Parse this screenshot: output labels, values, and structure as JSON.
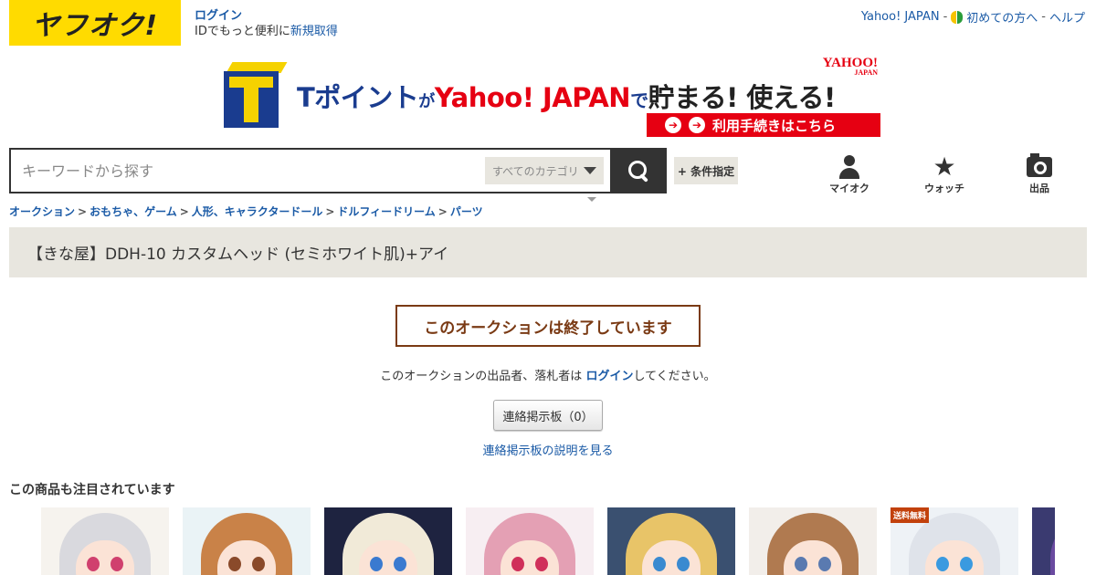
{
  "header": {
    "logo_text": "ヤフオク!",
    "login_label": "ログイン",
    "login_sub_prefix": "IDでもっと便利に",
    "register_label": "新規取得",
    "toplinks": {
      "yahoo_japan": "Yahoo! JAPAN",
      "sep1": "-",
      "beginner": "初めての方へ",
      "sep2": "-",
      "help": "ヘルプ"
    }
  },
  "banner": {
    "text_t": "Tポイント",
    "text_ga": "が",
    "text_yahoo": "Yahoo! JAPAN",
    "text_de": "で",
    "text_main": "貯まる! 使える!",
    "logo_yahoo": "YAHOO!",
    "logo_japan": "JAPAN",
    "cta": "利用手続きはこちら"
  },
  "search": {
    "placeholder": "キーワードから探す",
    "category": "すべてのカテゴリ",
    "condition_button": "+ 条件指定"
  },
  "nav": {
    "myauction": "マイオク",
    "watch": "ウォッチ",
    "sell": "出品"
  },
  "breadcrumb": {
    "items": [
      "オークション",
      "おもちゃ、ゲーム",
      "人形、キャラクタードール",
      "ドルフィードリーム",
      "パーツ"
    ],
    "separator": ">"
  },
  "item": {
    "title": "【きな屋】DDH-10 カスタムヘッド (セミホワイト肌)+アイ"
  },
  "ended": {
    "message": "このオークションは終了しています",
    "note_prefix": "このオークションの出品者、落札者は ",
    "note_login": "ログイン",
    "note_suffix": "してください。",
    "board_button": "連絡掲示板（0）",
    "board_help": "連絡掲示板の説明を見る"
  },
  "recommended": {
    "title": "この商品も注目されています",
    "free_shipping_badge": "送料無料",
    "items": [
      {
        "hair": "#d9d9de",
        "eye": "#d0406e",
        "bg": "#f6f3ee"
      },
      {
        "hair": "#c98248",
        "eye": "#8a4a2a",
        "bg": "#eaf3f6"
      },
      {
        "hair": "#f1ead8",
        "eye": "#3a7ad0",
        "bg": "#1e2340"
      },
      {
        "hair": "#e4a0b4",
        "eye": "#d0305a",
        "bg": "#f7eef2"
      },
      {
        "hair": "#e8c468",
        "eye": "#3a8ad0",
        "bg": "#3a5070"
      },
      {
        "hair": "#b07a50",
        "eye": "#5a7ab0",
        "bg": "#f2eeea"
      },
      {
        "hair": "#dfe3ea",
        "eye": "#3a9ae0",
        "bg": "#eef2f6"
      },
      {
        "hair": "#6a4aa0",
        "eye": "#6a4aa0",
        "bg": "#3a3a70"
      }
    ]
  }
}
